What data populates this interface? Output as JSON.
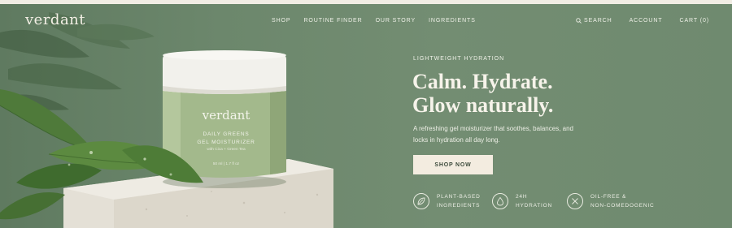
{
  "brand": {
    "logo_text": "verdant"
  },
  "nav": {
    "items": [
      {
        "label": "SHOP"
      },
      {
        "label": "ROUTINE FINDER"
      },
      {
        "label": "OUR STORY"
      },
      {
        "label": "INGREDIENTS"
      }
    ],
    "search_label": "SEARCH",
    "account_label": "ACCOUNT",
    "cart_label": "CART (0)",
    "cart_count": 0
  },
  "hero": {
    "eyebrow": "LIGHTWEIGHT HYDRATION",
    "headline_line1": "Calm. Hydrate.",
    "headline_line2": "Glow naturally.",
    "body": "A refreshing gel moisturizer that soothes, balances, and locks in hydration all day long.",
    "cta_label": "SHOP NOW",
    "features": [
      {
        "icon": "leaf-icon",
        "line1": "PLANT-BASED",
        "line2": "INGREDIENTS"
      },
      {
        "icon": "droplet-icon",
        "line1": "24H",
        "line2": "HYDRATION"
      },
      {
        "icon": "no-clog-icon",
        "line1": "OIL-FREE &",
        "line2": "NON-COMEDOGENIC"
      }
    ]
  },
  "product": {
    "brand": "verdant",
    "name_line1": "DAILY GREENS",
    "name_line2": "GEL MOISTURIZER",
    "sub": "with Cica + Green Tea",
    "size": "50 ml | 1.7 fl oz"
  },
  "colors": {
    "background": "#6f8a6f",
    "jar": "#a3b98c",
    "lid": "#f2f1ec",
    "cta_bg": "#f3ece0",
    "text_light": "#f6f3ea"
  }
}
